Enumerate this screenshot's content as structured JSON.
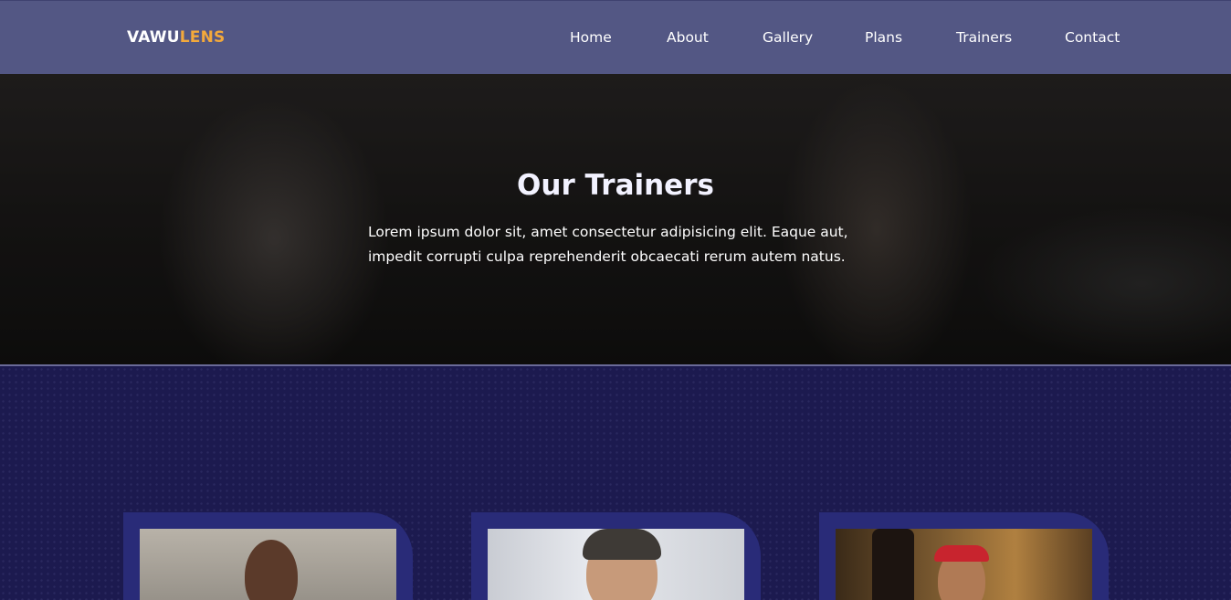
{
  "brand": {
    "part1": "VAWU",
    "part2": "LENS",
    "accent_color": "#f3a93b"
  },
  "nav": {
    "items": [
      "Home",
      "About",
      "Gallery",
      "Plans",
      "Trainers",
      "Contact"
    ]
  },
  "hero": {
    "title": "Our Trainers",
    "text": "Lorem ipsum dolor sit, amet consectetur adipisicing elit. Eaque aut, impedit corrupti culpa reprehenderit obcaecati rerum autem natus."
  },
  "colors": {
    "navbar": "#535784",
    "section_bg": "#1c1a4f",
    "card_bg": "#292b78"
  }
}
